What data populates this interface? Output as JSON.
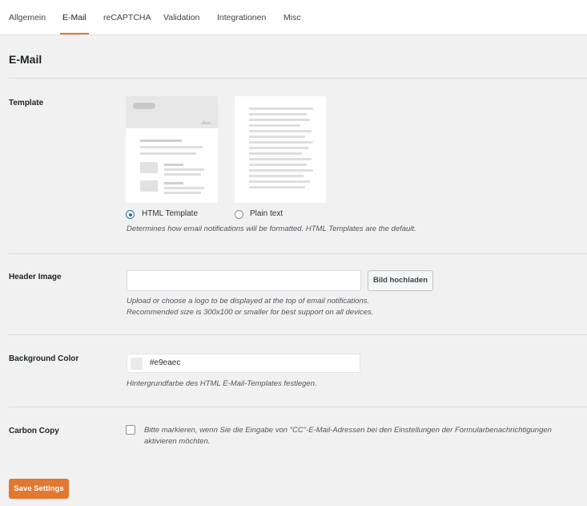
{
  "tabs": [
    {
      "label": "Allgemein",
      "active": false
    },
    {
      "label": "E-Mail",
      "active": true
    },
    {
      "label": "reCAPTCHA",
      "active": false
    },
    {
      "label": "Validation",
      "active": false
    },
    {
      "label": "Integrationen",
      "active": false
    },
    {
      "label": "Misc",
      "active": false
    }
  ],
  "page_title": "E-Mail",
  "template": {
    "label": "Template",
    "options": [
      {
        "label": "HTML Template",
        "selected": true
      },
      {
        "label": "Plain text",
        "selected": false
      }
    ],
    "description": "Determines how email notifications will be formatted. HTML Templates are the default."
  },
  "header_image": {
    "label": "Header Image",
    "value": "",
    "upload_label": "Bild hochladen",
    "description_line1": "Upload or choose a logo to be displayed at the top of email notifications.",
    "description_line2": "Recommended size is 300x100 or smaller for best support on all devices."
  },
  "background_color": {
    "label": "Background Color",
    "value": "#e9eaec",
    "swatch": "#e9eaec",
    "description": "Hintergrundfarbe des HTML E-Mail-Templates festlegen."
  },
  "carbon_copy": {
    "label": "Carbon Copy",
    "checked": false,
    "text": "Bitte markieren, wenn Sie die Eingabe von \"CC\"-E-Mail-Adressen bei den Einstellungen der Formularbenachrichtigungen aktivieren möchten."
  },
  "save_label": "Save Settings",
  "colors": {
    "accent": "#e27730",
    "radio": "#2c6da8"
  }
}
